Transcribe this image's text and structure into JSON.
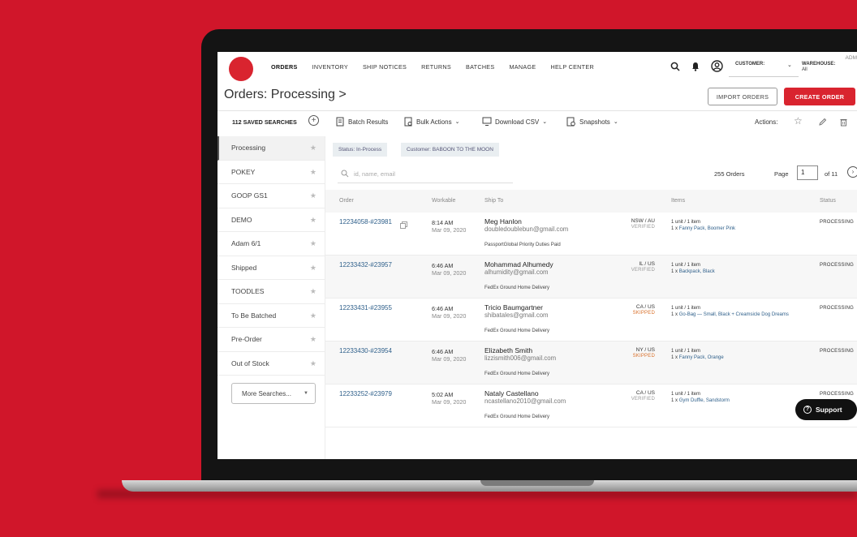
{
  "nav": {
    "items": [
      "ORDERS",
      "INVENTORY",
      "SHIP NOTICES",
      "RETURNS",
      "BATCHES",
      "MANAGE",
      "HELP CENTER"
    ],
    "customer_label": "CUSTOMER:",
    "warehouse_label": "WAREHOUSE:",
    "warehouse_value": "All",
    "admin_label": "ADM"
  },
  "header": {
    "title": "Orders: Processing >",
    "import_label": "IMPORT ORDERS",
    "create_label": "CREATE ORDER"
  },
  "toolbar": {
    "saved_searches": "112 SAVED SEARCHES",
    "plus": "+",
    "batch_results": "Batch Results",
    "bulk_actions": "Bulk Actions",
    "download_csv": "Download CSV",
    "snapshots": "Snapshots",
    "actions_label": "Actions:"
  },
  "sidebar": {
    "items": [
      {
        "label": "Processing"
      },
      {
        "label": "POKEY"
      },
      {
        "label": "GOOP GS1"
      },
      {
        "label": "DEMO"
      },
      {
        "label": "Adam 6/1"
      },
      {
        "label": "Shipped"
      },
      {
        "label": "TOODLES"
      },
      {
        "label": "To Be Batched"
      },
      {
        "label": "Pre-Order"
      },
      {
        "label": "Out of Stock"
      }
    ],
    "more_searches": "More Searches..."
  },
  "filters": {
    "status_chip": "Status: In-Process",
    "customer_chip": "Customer: BABOON TO THE MOON",
    "search_placeholder": "id, name, email",
    "orders_count": "255 Orders",
    "page_label": "Page",
    "page_value": "1",
    "of_label": "of 11"
  },
  "table": {
    "headers": {
      "order": "Order",
      "workable": "Workable",
      "ship_to": "Ship To",
      "items": "Items",
      "status": "Status"
    },
    "rows": [
      {
        "order": "12234058-#23981",
        "time": "8:14 AM",
        "date": "Mar 09, 2020",
        "name": "Meg Hanlon",
        "email": "doubledoublebun@gmail.com",
        "ship": "PassportGlobal Priority Duties Paid",
        "region": "NSW / AU",
        "verify": "VERIFIED",
        "units": "1 unit / 1 item",
        "item_qty": "1 x",
        "item": "Fanny Pack, Boomer Pink",
        "status": "PROCESSING"
      },
      {
        "order": "12233432-#23957",
        "time": "6:46 AM",
        "date": "Mar 09, 2020",
        "name": "Mohammad Alhumedy",
        "email": "alhumidity@gmail.com",
        "ship": "FedEx Ground Home Delivery",
        "region": "IL / US",
        "verify": "VERIFIED",
        "units": "1 unit / 1 item",
        "item_qty": "1 x",
        "item": "Backpack, Black",
        "status": "PROCESSING"
      },
      {
        "order": "12233431-#23955",
        "time": "6:46 AM",
        "date": "Mar 09, 2020",
        "name": "Tricio Baumgartner",
        "email": "shibatales@gmail.com",
        "ship": "FedEx Ground Home Delivery",
        "region": "CA / US",
        "verify": "SKIPPED",
        "units": "1 unit / 1 item",
        "item_qty": "1 x",
        "item": "Go-Bag — Small, Black + Creamsicle Dog Dreams",
        "status": "PROCESSING"
      },
      {
        "order": "12233430-#23954",
        "time": "6:46 AM",
        "date": "Mar 09, 2020",
        "name": "Elizabeth Smith",
        "email": "lizzismith006@gmail.com",
        "ship": "FedEx Ground Home Delivery",
        "region": "NY / US",
        "verify": "SKIPPED",
        "units": "1 unit / 1 item",
        "item_qty": "1 x",
        "item": "Fanny Pack, Orange",
        "status": "PROCESSING"
      },
      {
        "order": "12233252-#23979",
        "time": "5:02 AM",
        "date": "Mar 09, 2020",
        "name": "Nataly Castellano",
        "email": "ncastellano2010@gmail.com",
        "ship": "FedEx Ground Home Delivery",
        "region": "CA / US",
        "verify": "VERIFIED",
        "units": "1 unit / 1 item",
        "item_qty": "1 x",
        "item": "Gym Duffle, Sandstorm",
        "status": "PROCESSING"
      }
    ]
  },
  "support": {
    "label": "Support"
  },
  "colors": {
    "brand": "#d9242f",
    "background": "#d0162a",
    "link": "#2e5f8a"
  }
}
